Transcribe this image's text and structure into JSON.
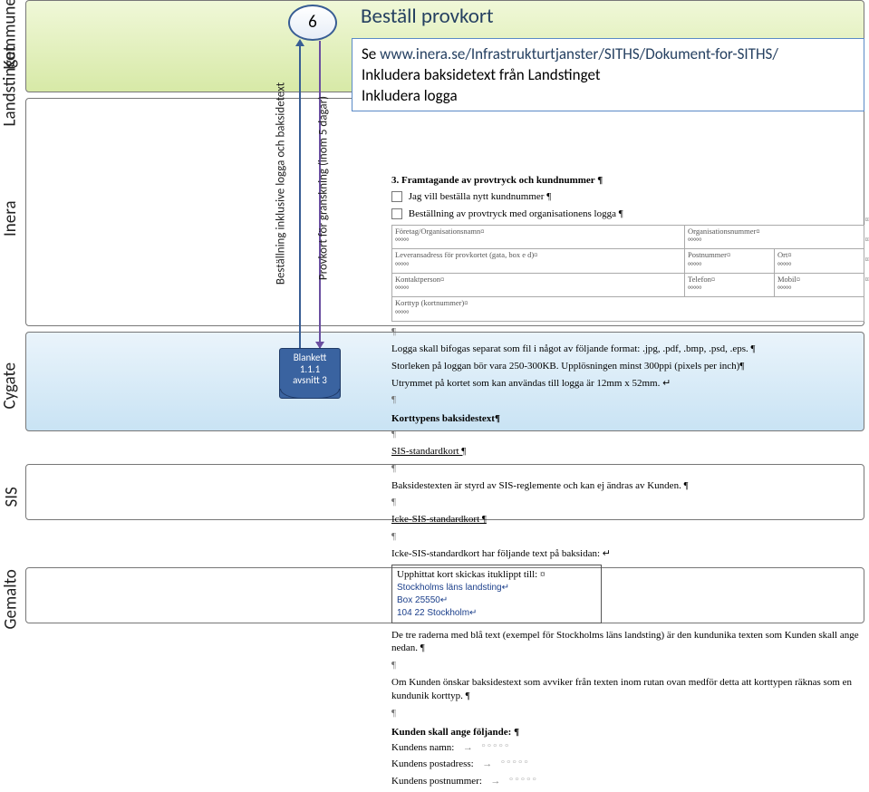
{
  "lanes": {
    "kommunen": "Kommunen",
    "landstinget": "Landstinget",
    "inera": "Inera",
    "cygate": "Cygate",
    "sis": "SIS",
    "gemalto": "Gemalto"
  },
  "step": {
    "number": "6",
    "label_order": "Beställning inklusive logga och baksidetext",
    "label_proof": "Provkort för granskning (inom 5 dagar)"
  },
  "blankett": {
    "line1": "Blankett",
    "line2": "1.1.1",
    "line3": "avsnitt 3"
  },
  "callout": {
    "title": "Beställ provkort",
    "see": "Se ",
    "url": "www.inera.se/Infrastrukturtjanster/SITHS/Dokument-for-SITHS/",
    "line2": "Inkludera baksidetext från Landstinget",
    "line3": "Inkludera logga"
  },
  "doc": {
    "h3": "3.  Framtagande av provtryck och kundnummer ¶",
    "opt1": " Jag vill beställa nytt kundnummer ¶",
    "opt2": " Beställning av provtryck med organisationens logga ¶",
    "row1": {
      "company": "Företag/Organisationsnamn¤",
      "org": "Organisationsnummer¤"
    },
    "row2": {
      "addr": "Leveransadress för provkortet (gata, box e d)¤",
      "post": "Postnummer¤",
      "ort": "Ort¤"
    },
    "row3": {
      "contact": "Kontaktperson¤",
      "tel": "Telefon¤",
      "mob": "Mobil¤"
    },
    "row4": {
      "type": "Korttyp (kortnummer)¤"
    },
    "placeholder": "°°°°°",
    "logo_p1": "Logga skall bifogas separat som fil i något av följande format: .jpg, .pdf, .bmp, .psd, .eps. ¶",
    "logo_p2": "Storleken på loggan bör vara 250-300KB. Upplösningen minst 300ppi (pixels per inch)¶",
    "logo_p3": "Utrymmet på kortet som kan användas till logga är 12mm x 52mm. ↵",
    "h4a": "Korttypens baksidestext¶",
    "sis_h": "SIS-standardkort ¶",
    "sis_p": "Baksidestexten är styrd av SIS-reglemente och kan ej ändras av Kunden. ¶",
    "icke_h": "Icke-SIS-standardkort ¶",
    "icke_p": "Icke-SIS-standardkort har följande text på baksidan: ↵",
    "box_line1": "Upphittat kort skickas ituklippt till:  ¤",
    "box_line2": "Stockholms läns landsting↵",
    "box_line3": "Box 25550↵",
    "box_line4": "104 22 Stockholm↵",
    "after1": "De tre raderna med blå text (exempel för Stockholms läns landsting) är den kundunika texten som Kunden skall ange nedan. ¶",
    "after2": "Om Kunden önskar baksidestext som avviker från texten inom rutan ovan medför detta att korttypen räknas som en kundunik korttyp. ¶",
    "h4b": "Kunden skall ange följande: ¶",
    "k1": "Kundens namn:",
    "k2": "Kundens postadress:",
    "k3": "Kundens postnummer:"
  }
}
